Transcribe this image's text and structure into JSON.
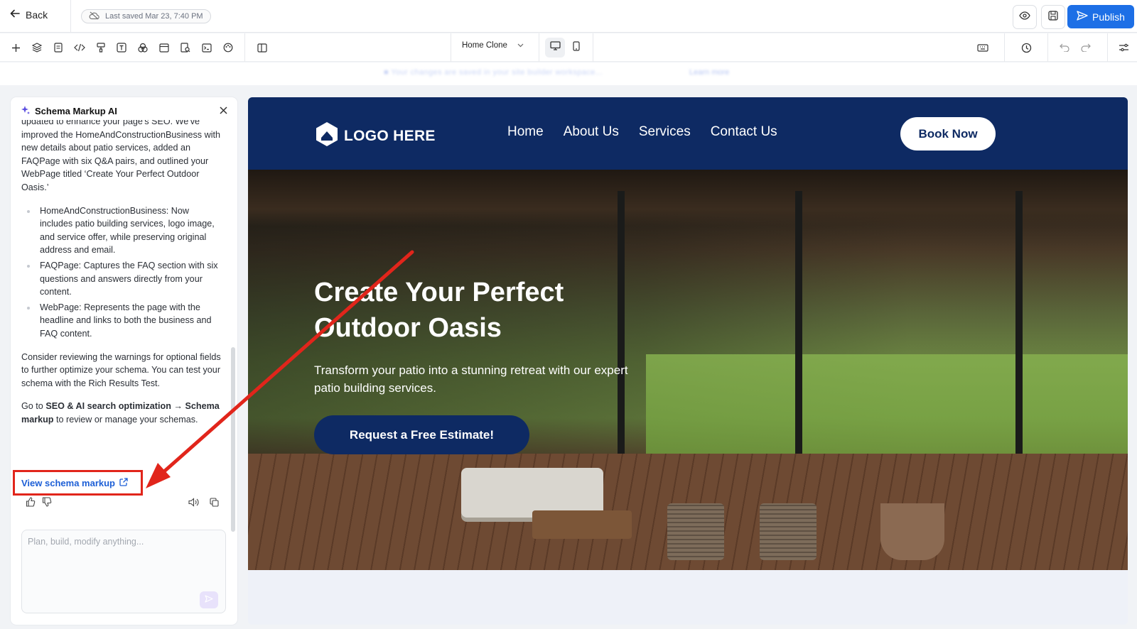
{
  "topbar": {
    "back_label": "Back",
    "saved_status": "Last saved Mar 23, 7:40 PM",
    "publish_label": "Publish",
    "accent_color": "#1d6fe6"
  },
  "toolbar": {
    "page_select": "Home Clone",
    "icons": [
      "add-icon",
      "layers-icon",
      "pages-icon",
      "code-icon",
      "paint-icon",
      "text-icon",
      "shapes-icon",
      "window-icon",
      "seo-icon",
      "terminal-icon",
      "palette-icon",
      "sidebar-icon"
    ]
  },
  "banner": {
    "text": "■ Your changes are saved in your site builder workspace...",
    "link": "Learn more"
  },
  "ai_panel": {
    "title": "Schema Markup AI",
    "intro_partial": "updated to enhance your page's SEO. We've",
    "intro": "improved the HomeAndConstructionBusiness with new details about patio services, added an FAQPage with six Q&A pairs, and outlined your WebPage titled ‘Create Your Perfect Outdoor Oasis.’",
    "bullets": [
      "HomeAndConstructionBusiness: Now includes patio building services, logo image, and service offer, while preserving original address and email.",
      "FAQPage: Captures the FAQ section with six questions and answers directly from your content.",
      "WebPage: Represents the page with the headline and links to both the business and FAQ content."
    ],
    "review_text": "Consider reviewing the warnings for optional fields to further optimize your schema. You can test your schema with the Rich Results Test.",
    "goto_prefix": "Go to ",
    "goto_bold": "SEO & AI search optimization → Schema markup",
    "goto_suffix": " to review or manage your schemas.",
    "view_link": "View schema markup",
    "input_placeholder": "Plan, build, modify anything..."
  },
  "site": {
    "logo_text": "LOGO HERE",
    "nav": [
      "Home",
      "About Us",
      "Services",
      "Contact Us"
    ],
    "book_label": "Book Now",
    "hero_title": "Create Your Perfect Outdoor Oasis",
    "hero_sub": "Transform your patio into a stunning retreat with our expert patio building services.",
    "cta_label": "Request a Free Estimate!",
    "brand_color": "#0e2a63"
  },
  "annotation": {
    "color": "#e1251b"
  }
}
